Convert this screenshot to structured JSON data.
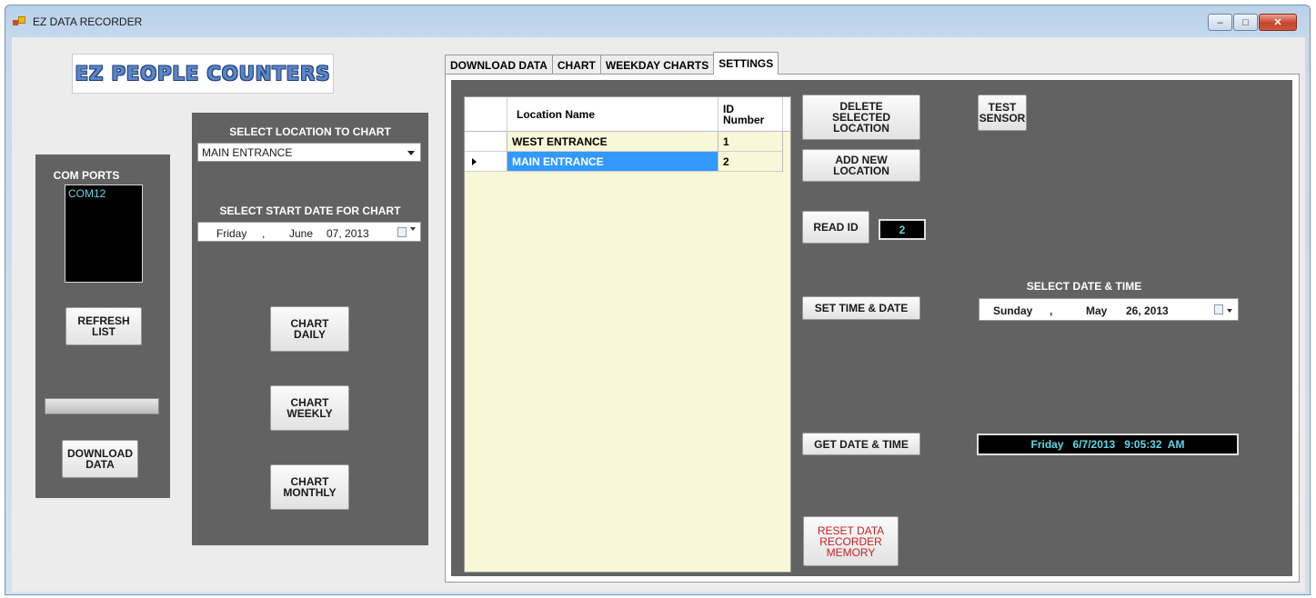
{
  "window": {
    "title": "EZ DATA RECORDER",
    "controls": {
      "minimize": "‒",
      "maximize": "□",
      "close": "✕"
    }
  },
  "logo": {
    "text": "EZ PEOPLE COUNTERS"
  },
  "com_panel": {
    "title": "COM PORTS",
    "ports": [
      "COM12"
    ],
    "refresh_label": "REFRESH\nLIST",
    "download_label": "DOWNLOAD\nDATA"
  },
  "chart_panel": {
    "location_title": "SELECT LOCATION TO CHART",
    "location_value": "MAIN ENTRANCE",
    "start_date_title": "SELECT START DATE FOR CHART",
    "start_date": {
      "weekday": "Friday",
      "sep": ",",
      "month": "June",
      "day_year": "07, 2013"
    },
    "daily_label": "CHART\nDAILY",
    "weekly_label": "CHART\nWEEKLY",
    "monthly_label": "CHART\nMONTHLY"
  },
  "tabs": [
    {
      "label": "DOWNLOAD DATA"
    },
    {
      "label": "CHART"
    },
    {
      "label": "WEEKDAY CHARTS"
    },
    {
      "label": "SETTINGS"
    }
  ],
  "settings": {
    "grid": {
      "columns": [
        "Location Name",
        "ID\nNumber"
      ],
      "rows": [
        {
          "name": "WEST ENTRANCE",
          "id": "1"
        },
        {
          "name": "MAIN ENTRANCE",
          "id": "2"
        }
      ]
    },
    "delete_label": "DELETE\nSELECTED\nLOCATION",
    "add_label": "ADD NEW\nLOCATION",
    "test_label": "TEST\nSENSOR",
    "read_id_label": "READ ID",
    "read_id_value": "2",
    "select_datetime_title": "SELECT DATE & TIME",
    "set_time_label": "SET TIME & DATE",
    "set_date": {
      "weekday": "Sunday",
      "sep": ",",
      "month": "May",
      "day_year": "26, 2013"
    },
    "get_time_label": "GET DATE & TIME",
    "get_time_value": "Friday   6/7/2013   9:05:32  AM",
    "reset_label": "RESET DATA\nRECORDER\nMEMORY"
  }
}
